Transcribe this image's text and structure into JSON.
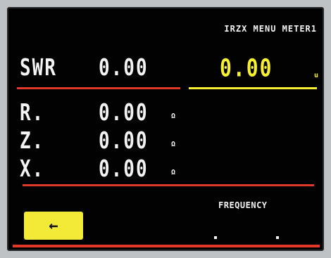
{
  "header": {
    "title": "IRZX MENU METER1"
  },
  "swr": {
    "label": "SWR",
    "value": "0.00",
    "value_secondary": "0.00",
    "unit_secondary": "u"
  },
  "rows": [
    {
      "label": "R.",
      "value": "0.00",
      "unit": "Ω"
    },
    {
      "label": "Z.",
      "value": "0.00",
      "unit": "Ω"
    },
    {
      "label": "X.",
      "value": "0.00",
      "unit": "Ω"
    }
  ],
  "back_button": {
    "label": "←"
  },
  "frequency": {
    "label": "FREQUENCY"
  },
  "colors": {
    "accent_red": "#e2382a",
    "accent_yellow": "#f6f030",
    "background": "#020202"
  }
}
